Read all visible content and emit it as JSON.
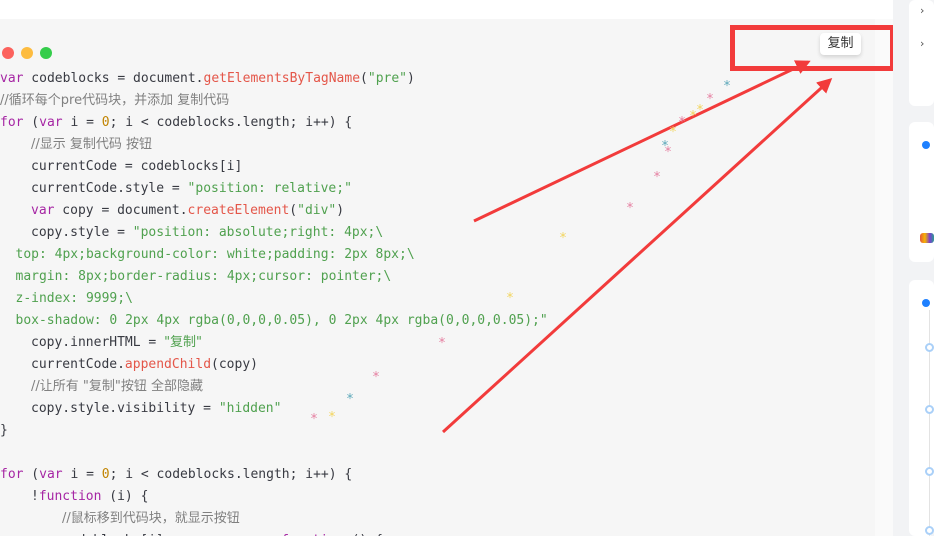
{
  "window": {
    "controls": [
      "close",
      "minimize",
      "maximize"
    ]
  },
  "copy_button": {
    "label": "复制"
  },
  "code": {
    "lines": [
      {
        "indent": 0,
        "tokens": [
          [
            "kw",
            "var"
          ],
          [
            "p",
            " codeblocks = document."
          ],
          [
            "fn",
            "getElementsByTagName"
          ],
          [
            "p",
            "("
          ],
          [
            "str",
            "\"pre\""
          ],
          [
            "p",
            ")"
          ]
        ]
      },
      {
        "indent": 0,
        "tokens": [
          [
            "cm",
            "//循环每个pre代码块，并添加 复制代码"
          ]
        ]
      },
      {
        "indent": 0,
        "tokens": [
          [
            "kw",
            "for"
          ],
          [
            "p",
            " ("
          ],
          [
            "kw",
            "var"
          ],
          [
            "p",
            " i = "
          ],
          [
            "num",
            "0"
          ],
          [
            "p",
            "; i < codeblocks.length; i++) {"
          ]
        ]
      },
      {
        "indent": 1,
        "tokens": [
          [
            "cm",
            "//显示 复制代码 按钮"
          ]
        ]
      },
      {
        "indent": 1,
        "tokens": [
          [
            "p",
            "currentCode = codeblocks[i]"
          ]
        ]
      },
      {
        "indent": 1,
        "tokens": [
          [
            "p",
            "currentCode.style = "
          ],
          [
            "str",
            "\"position: relative;\""
          ]
        ]
      },
      {
        "indent": 1,
        "tokens": [
          [
            "kw",
            "var"
          ],
          [
            "p",
            " copy = document."
          ],
          [
            "fn",
            "createElement"
          ],
          [
            "p",
            "("
          ],
          [
            "str",
            "\"div\""
          ],
          [
            "p",
            ")"
          ]
        ]
      },
      {
        "indent": 1,
        "tokens": [
          [
            "p",
            "copy.style = "
          ],
          [
            "str",
            "\"position: absolute;right: 4px;\\"
          ]
        ]
      },
      {
        "indent": 0.5,
        "tokens": [
          [
            "str",
            "top: 4px;background-color: white;padding: 2px 8px;\\"
          ]
        ]
      },
      {
        "indent": 0.5,
        "tokens": [
          [
            "str",
            "margin: 8px;border-radius: 4px;cursor: pointer;\\"
          ]
        ]
      },
      {
        "indent": 0.5,
        "tokens": [
          [
            "str",
            "z-index: 9999;\\"
          ]
        ]
      },
      {
        "indent": 0.5,
        "tokens": [
          [
            "str",
            "box-shadow: 0 2px 4px rgba(0,0,0,0.05), 0 2px 4px rgba(0,0,0,0.05);\""
          ]
        ]
      },
      {
        "indent": 1,
        "tokens": [
          [
            "p",
            "copy.innerHTML = "
          ],
          [
            "str",
            "\"复制\""
          ]
        ]
      },
      {
        "indent": 1,
        "tokens": [
          [
            "p",
            "currentCode."
          ],
          [
            "fn",
            "appendChild"
          ],
          [
            "p",
            "(copy)"
          ]
        ]
      },
      {
        "indent": 1,
        "tokens": [
          [
            "cm",
            "//让所有 \"复制\"按钮 全部隐藏"
          ]
        ]
      },
      {
        "indent": 1,
        "tokens": [
          [
            "p",
            "copy.style.visibility = "
          ],
          [
            "str",
            "\"hidden\""
          ]
        ]
      },
      {
        "indent": 0,
        "tokens": [
          [
            "p",
            "}"
          ]
        ]
      },
      {
        "indent": 0,
        "tokens": []
      },
      {
        "indent": 0,
        "tokens": [
          [
            "kw",
            "for"
          ],
          [
            "p",
            " ("
          ],
          [
            "kw",
            "var"
          ],
          [
            "p",
            " i = "
          ],
          [
            "num",
            "0"
          ],
          [
            "p",
            "; i < codeblocks.length; i++) {"
          ]
        ]
      },
      {
        "indent": 1,
        "tokens": [
          [
            "p",
            "!"
          ],
          [
            "kw",
            "function"
          ],
          [
            "p",
            " (i) {"
          ]
        ]
      },
      {
        "indent": 2,
        "tokens": [
          [
            "cm",
            "//鼠标移到代码块，就显示按钮"
          ]
        ]
      },
      {
        "indent": 2,
        "tokens": [
          [
            "p",
            "codeblocks[i].onmouseover = "
          ],
          [
            "kw",
            "function"
          ],
          [
            "p",
            " () {"
          ]
        ]
      }
    ]
  },
  "annotation": {
    "box_color": "#f23b3b",
    "arrow_color": "#f23b3b"
  },
  "decorations": {
    "sparkle_colors": [
      "#e57ea0",
      "#f2d45c",
      "#5aa7b8"
    ]
  },
  "colors": {
    "keyword": "#a626a4",
    "function": "#e45649",
    "string": "#50a14f",
    "number": "#c18401",
    "comment": "#808080",
    "code_bg": "#f6f6f6"
  }
}
